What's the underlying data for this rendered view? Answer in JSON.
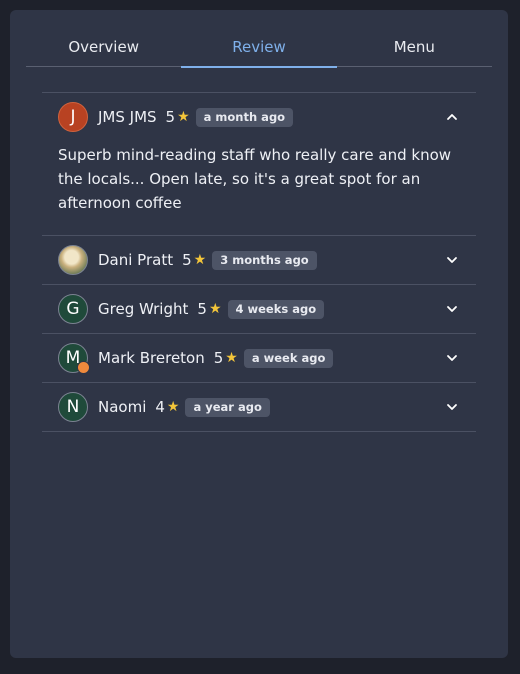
{
  "tabs": [
    {
      "label": "Overview",
      "active": false
    },
    {
      "label": "Review",
      "active": true
    },
    {
      "label": "Menu",
      "active": false
    }
  ],
  "reviews": [
    {
      "avatar_letter": "J",
      "name": "JMS JMS",
      "rating": "5",
      "time": "a month ago",
      "expanded": true,
      "text": "Superb mind-reading staff who really care and know the locals... Open late, so it's a great spot for an afternoon coffee"
    },
    {
      "avatar_letter": "",
      "name": "Dani Pratt",
      "rating": "5",
      "time": "3 months ago",
      "expanded": false
    },
    {
      "avatar_letter": "G",
      "name": "Greg Wright",
      "rating": "5",
      "time": "4 weeks ago",
      "expanded": false
    },
    {
      "avatar_letter": "M",
      "name": "Mark Brereton",
      "rating": "5",
      "time": "a week ago",
      "expanded": false
    },
    {
      "avatar_letter": "N",
      "name": "Naomi",
      "rating": "4",
      "time": "a year ago",
      "expanded": false
    }
  ],
  "colors": {
    "accent": "#7fb0ea",
    "star": "#f3c53a",
    "panel": "#2f3546"
  },
  "icons": {
    "star": "star-icon",
    "expand": "chevron-down-icon",
    "collapse": "chevron-up-icon"
  }
}
